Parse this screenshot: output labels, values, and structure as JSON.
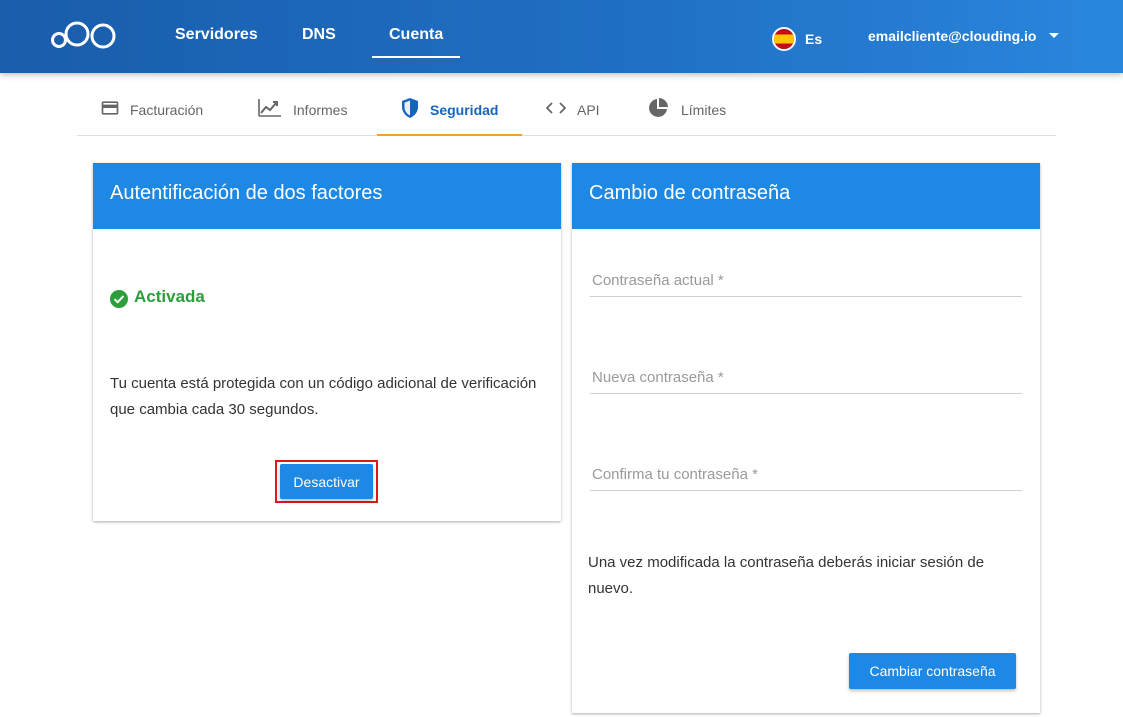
{
  "topbar": {
    "nav": [
      {
        "label": "Servidores"
      },
      {
        "label": "DNS"
      },
      {
        "label": "Cuenta",
        "active": true
      }
    ],
    "language": "Es",
    "user_email": "emailcliente@clouding.io"
  },
  "subtabs": [
    {
      "label": "Facturación",
      "icon": "credit-card-icon"
    },
    {
      "label": "Informes",
      "icon": "trending-up-icon"
    },
    {
      "label": "Seguridad",
      "icon": "shield-icon",
      "active": true
    },
    {
      "label": "API",
      "icon": "code-icon"
    },
    {
      "label": "Límites",
      "icon": "pie-chart-icon"
    }
  ],
  "two_factor": {
    "title": "Autentificación de dos factores",
    "status": "Activada",
    "description": "Tu cuenta está protegida con un código adicional de verificación que cambia cada 30 segundos.",
    "button": "Desactivar"
  },
  "password_change": {
    "title": "Cambio de contraseña",
    "fields": [
      {
        "placeholder": "Contraseña actual *",
        "value": ""
      },
      {
        "placeholder": "Nueva contraseña *",
        "value": ""
      },
      {
        "placeholder": "Confirma tu contraseña *",
        "value": ""
      }
    ],
    "note": "Una vez modificada la contraseña deberás iniciar sesión de nuevo.",
    "button": "Cambiar contraseña"
  },
  "colors": {
    "primary": "#1e88e5",
    "topbar": "#1f6fc4",
    "success": "#2e9e3c",
    "tab_indicator": "#f0a030",
    "highlight": "#e0161d"
  }
}
